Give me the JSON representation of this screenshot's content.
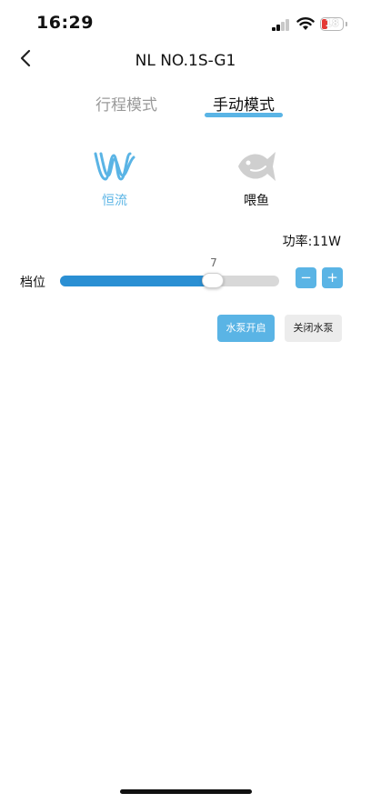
{
  "status_bar": {
    "time": "16:29",
    "battery_level": "18",
    "battery_color": "#e53935"
  },
  "nav": {
    "title": "NL NO.1S-G1",
    "back_icon": "chevron-left-icon"
  },
  "tabs": [
    {
      "label": "行程模式",
      "active": false
    },
    {
      "label": "手动模式",
      "active": true
    }
  ],
  "modes": [
    {
      "label": "恒流",
      "icon": "constant-flow-icon",
      "selected": true
    },
    {
      "label": "喂鱼",
      "icon": "fish-icon",
      "selected": false
    }
  ],
  "power": {
    "label": "功率:11W"
  },
  "gear": {
    "label": "档位",
    "value": "7",
    "fraction": 0.7,
    "minus": "−",
    "plus": "+"
  },
  "buttons": {
    "pump_on": "水泵开启",
    "pump_off": "关闭水泵"
  },
  "colors": {
    "accent": "#5ab4e5",
    "slider_fill": "#2a8fd3",
    "inactive_tab": "#9a9a9a",
    "fish_icon": "#cfcfcf"
  }
}
